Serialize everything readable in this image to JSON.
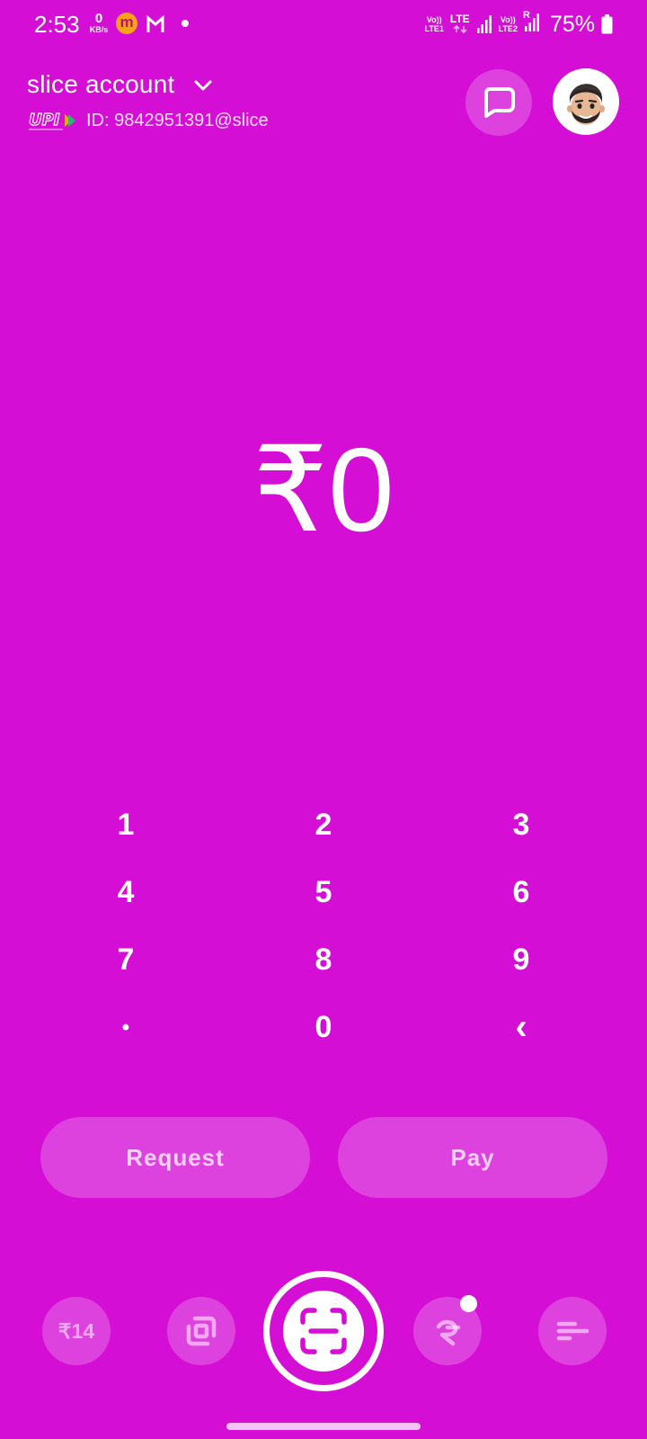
{
  "status_bar": {
    "time": "2:53",
    "net_speed": "0",
    "net_unit": "KB/s",
    "app_icon_letter": "m",
    "sim1_top": "Vo))",
    "sim1_bottom": "LTE1",
    "lte_label": "LTE",
    "sim2_top": "Vo))",
    "sim2_bottom": "LTE2",
    "roaming": "R",
    "battery": "75%"
  },
  "header": {
    "account_title": "slice account",
    "upi_logo_text": "UPI",
    "upi_id": "ID: 9842951391@slice"
  },
  "amount": {
    "display": "₹0"
  },
  "keypad": {
    "keys": [
      "1",
      "2",
      "3",
      "4",
      "5",
      "6",
      "7",
      "8",
      "9",
      "•",
      "0",
      "‹"
    ]
  },
  "actions": {
    "request_label": "Request",
    "pay_label": "Pay"
  },
  "bottom_nav": {
    "rewards_label": "₹14",
    "items": [
      "rewards",
      "cards-icon",
      "scan-qr-icon",
      "credit-icon",
      "menu-icon"
    ]
  },
  "colors": {
    "background": "#d50ed5",
    "foreground": "#ffffff",
    "app_icon": "#f6a21a"
  }
}
